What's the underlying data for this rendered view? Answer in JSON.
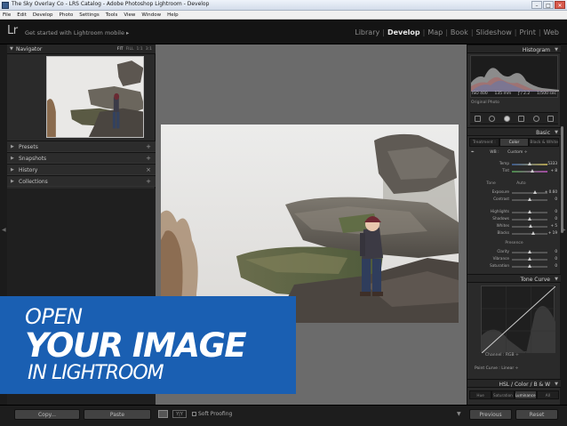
{
  "window": {
    "title": "The Sky Overlay Co - LRS Catalog - Adobe Photoshop Lightroom - Develop",
    "controls": [
      "–",
      "□",
      "✕"
    ]
  },
  "menu": [
    "File",
    "Edit",
    "Develop",
    "Photo",
    "Settings",
    "Tools",
    "View",
    "Window",
    "Help"
  ],
  "identity": {
    "logo": "Lr",
    "mobile_prompt": "Get started with Lightroom mobile ▸"
  },
  "modules": [
    {
      "label": "Library",
      "active": false
    },
    {
      "label": "Develop",
      "active": true
    },
    {
      "label": "Map",
      "active": false
    },
    {
      "label": "Book",
      "active": false
    },
    {
      "label": "Slideshow",
      "active": false
    },
    {
      "label": "Print",
      "active": false
    },
    {
      "label": "Web",
      "active": false
    }
  ],
  "left_panel": {
    "navigator": {
      "label": "Navigator",
      "zooms": [
        "FIT",
        "FILL",
        "1:1",
        "3:1"
      ],
      "active_zoom": "FIT"
    },
    "rows": [
      {
        "label": "Presets"
      },
      {
        "label": "Snapshots"
      },
      {
        "label": "History"
      },
      {
        "label": "Collections"
      }
    ]
  },
  "right_panel": {
    "histogram": {
      "label": "Histogram",
      "info": [
        "ISO 400",
        "135 mm",
        "ƒ / 2.2",
        "1/500 sec"
      ],
      "original_photo": "Original Photo"
    },
    "basic": {
      "label": "Basic",
      "treatment_tabs": [
        "Treatment :",
        "Color",
        "Black & White"
      ],
      "wb_label": "WB :",
      "wb_value": "Custom ÷",
      "temp_label": "Temp",
      "temp_value": "5333",
      "tint_label": "Tint",
      "tint_value": "+ 8",
      "tone_label": "Tone",
      "auto_label": "Auto",
      "sliders": [
        {
          "label": "Exposure",
          "value": "+ 0.60"
        },
        {
          "label": "Contrast",
          "value": "0"
        },
        {
          "label": "Highlights",
          "value": "0"
        },
        {
          "label": "Shadows",
          "value": "0"
        },
        {
          "label": "Whites",
          "value": "+ 5"
        },
        {
          "label": "Blacks",
          "value": "+ 19"
        }
      ],
      "presence_label": "Presence",
      "presence_sliders": [
        {
          "label": "Clarity",
          "value": "0"
        },
        {
          "label": "Vibrance",
          "value": "0"
        },
        {
          "label": "Saturation",
          "value": "0"
        }
      ]
    },
    "tone_curve": {
      "label": "Tone Curve",
      "channel": "Channel :   RGB ÷",
      "point_curve": "Point Curve :   Linear ÷"
    },
    "hsl": {
      "label": "HSL  /  Color  /  B & W",
      "tabs": [
        "Hue",
        "Saturation",
        "Luminance",
        "All"
      ],
      "active_tab": "Luminance"
    }
  },
  "bottom": {
    "copy": "Copy...",
    "paste": "Paste",
    "previous": "Previous",
    "reset": "Reset",
    "soft_proofing": "Soft Proofing",
    "yy": "Y|Y"
  },
  "banner": {
    "line1": "OPEN",
    "line2": "YOUR IMAGE",
    "line3": "IN LIGHTROOM",
    "color": "#1a5fb2"
  }
}
